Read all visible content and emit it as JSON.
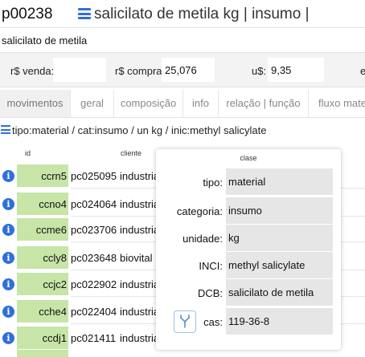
{
  "header": {
    "code": "p00238",
    "title": "salicilato de metila kg | insumo |"
  },
  "name_field": {
    "value": "salicilato de metila"
  },
  "prices": {
    "venda_label": "r$ venda:",
    "venda_value": "",
    "compra_label": "r$ compra:",
    "compra_value": "25,076",
    "usd_label": "u$:",
    "usd_value": "9,35",
    "extra_label": "e"
  },
  "tabs": [
    {
      "label": "movimentos",
      "active": true
    },
    {
      "label": "geral"
    },
    {
      "label": "composição"
    },
    {
      "label": "info"
    },
    {
      "label": "relação | função"
    },
    {
      "label": "fluxo mater"
    }
  ],
  "filter": {
    "text": "tipo:material / cat:insumo / un kg / inic:methyl salicylate"
  },
  "table": {
    "headers": {
      "id": "id",
      "cliente": "cliente"
    },
    "rows": [
      {
        "id": "ccrn5",
        "pc": "pc025095",
        "cliente": "industria"
      },
      {
        "id": "ccno4",
        "pc": "pc024064",
        "cliente": "industria"
      },
      {
        "id": "ccme6",
        "pc": "pc023706",
        "cliente": "industria"
      },
      {
        "id": "ccly8",
        "pc": "pc023648",
        "cliente": "biovital"
      },
      {
        "id": "ccjc2",
        "pc": "pc022902",
        "cliente": "industria"
      },
      {
        "id": "cche4",
        "pc": "pc022404",
        "cliente": "industria"
      },
      {
        "id": "ccdj1",
        "pc": "pc021411",
        "cliente": "industria"
      }
    ]
  },
  "popup": {
    "title": "clase",
    "fields": [
      {
        "label": "tipo:",
        "value": "material"
      },
      {
        "label": "categoria:",
        "value": "insumo"
      },
      {
        "label": "unidade:",
        "value": " kg"
      },
      {
        "label": "INCI:",
        "value": "methyl salicylate"
      },
      {
        "label": "DCB:",
        "value": "salicilato de metila"
      },
      {
        "label": "cas:",
        "value": "119-36-8"
      }
    ]
  },
  "colors": {
    "accent": "#2f6fdb",
    "id_cell": "#c6e5a7",
    "field_bg": "#e6e6e6"
  }
}
